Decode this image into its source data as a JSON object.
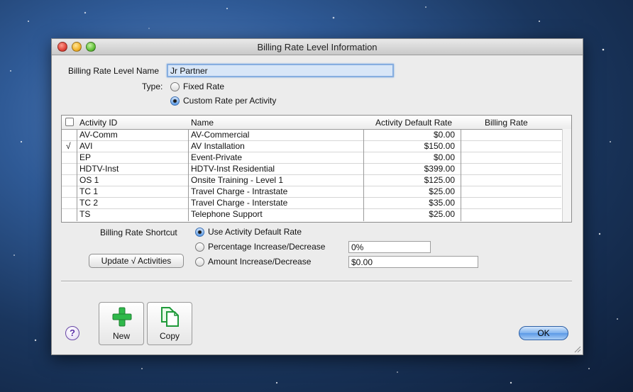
{
  "window": {
    "title": "Billing Rate Level Information"
  },
  "form": {
    "name_label": "Billing Rate Level Name",
    "name_value": "Jr Partner",
    "type_label": "Type:",
    "type_options": [
      "Fixed Rate",
      "Custom Rate per Activity"
    ],
    "type_selected": "Custom Rate per Activity"
  },
  "table": {
    "headers": {
      "activity_id": "Activity ID",
      "name": "Name",
      "default_rate": "Activity Default Rate",
      "billing_rate": "Billing Rate"
    },
    "rows": [
      {
        "check": "",
        "id": "AV-Comm",
        "name": "AV-Commercial",
        "rate": "$0.00",
        "billing": ""
      },
      {
        "check": "√",
        "id": "AVI",
        "name": "AV Installation",
        "rate": "$150.00",
        "billing": ""
      },
      {
        "check": "",
        "id": "EP",
        "name": "Event-Private",
        "rate": "$0.00",
        "billing": ""
      },
      {
        "check": "",
        "id": "HDTV-Inst",
        "name": "HDTV-Inst Residential",
        "rate": "$399.00",
        "billing": ""
      },
      {
        "check": "",
        "id": "OS 1",
        "name": "Onsite Training - Level 1",
        "rate": "$125.00",
        "billing": ""
      },
      {
        "check": "",
        "id": "TC 1",
        "name": "Travel Charge - Intrastate",
        "rate": "$25.00",
        "billing": ""
      },
      {
        "check": "",
        "id": "TC 2",
        "name": "Travel Charge - Interstate",
        "rate": "$35.00",
        "billing": ""
      },
      {
        "check": "",
        "id": "TS",
        "name": "Telephone Support",
        "rate": "$25.00",
        "billing": ""
      }
    ]
  },
  "shortcut": {
    "label": "Billing Rate Shortcut",
    "options": [
      "Use Activity Default Rate",
      "Percentage Increase/Decrease",
      "Amount Increase/Decrease"
    ],
    "selected": "Use Activity Default Rate",
    "percent_value": "0%",
    "amount_value": "$0.00",
    "update_button": "Update √ Activities"
  },
  "buttons": {
    "new": "New",
    "copy": "Copy",
    "ok": "OK",
    "help": "?"
  },
  "colors": {
    "accent": "#5b99e6",
    "new_icon": "#2fb84a",
    "copy_icon": "#2fb84a"
  }
}
